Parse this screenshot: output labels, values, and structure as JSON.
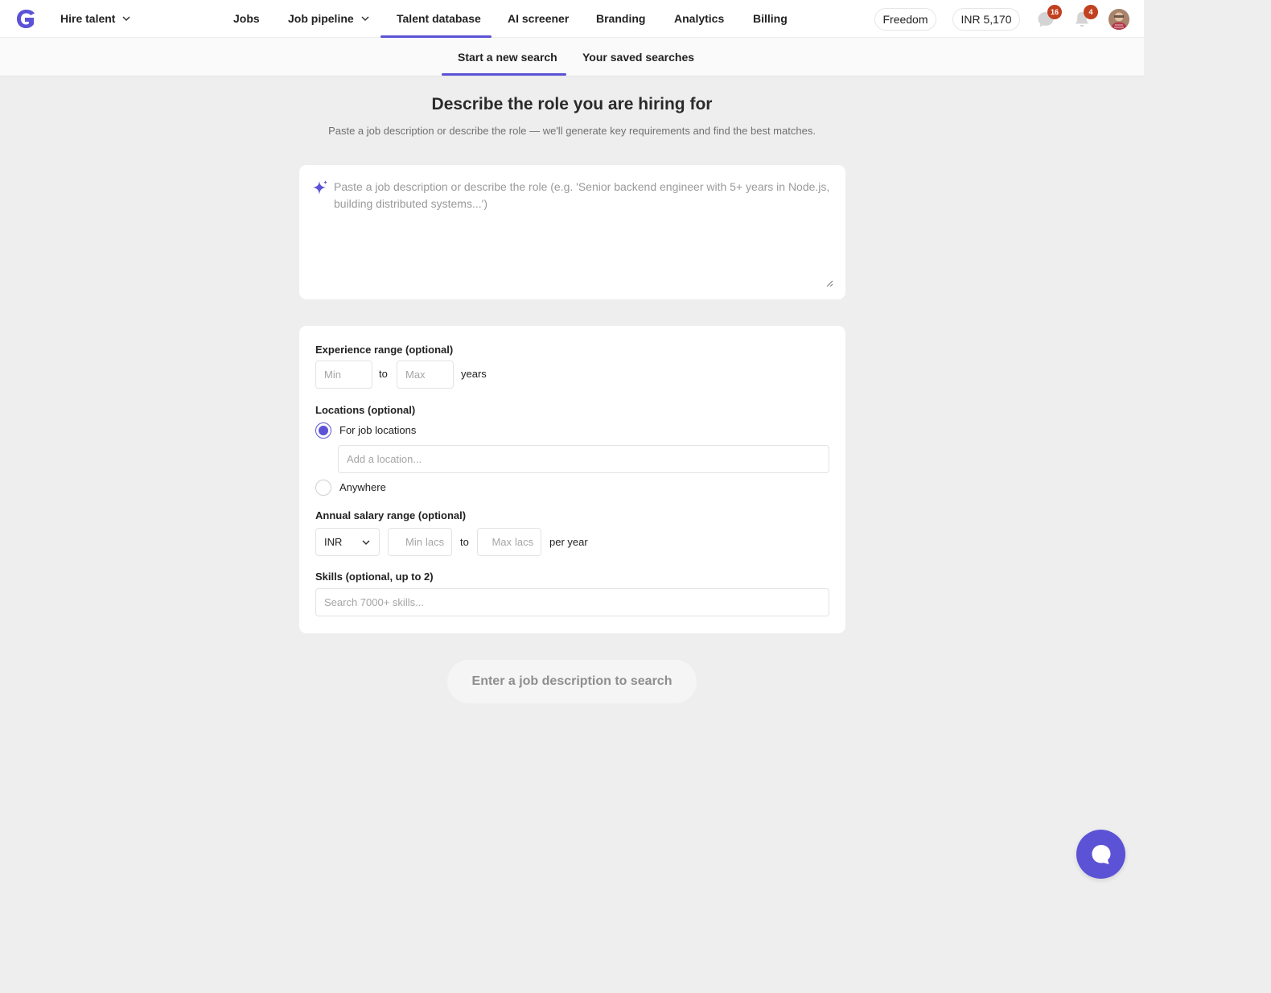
{
  "header": {
    "hire_menu": "Hire talent",
    "nav": [
      {
        "label": "Jobs"
      },
      {
        "label": "Job pipeline"
      },
      {
        "label": "Talent database"
      },
      {
        "label": "AI screener"
      },
      {
        "label": "Branding"
      },
      {
        "label": "Analytics"
      },
      {
        "label": "Billing"
      }
    ],
    "plan": "Freedom",
    "balance": "INR 5,170",
    "messages_count": "16",
    "notifications_count": "4"
  },
  "subnav": {
    "tabs": [
      {
        "label": "Start a new search"
      },
      {
        "label": "Your saved searches"
      }
    ]
  },
  "main": {
    "title": "Describe the role you are hiring for",
    "subtitle": "Paste a job description or describe the role — we'll generate key requirements and find the best matches.",
    "jd_placeholder": "Paste a job description or describe the role (e.g. 'Senior backend engineer with 5+ years in Node.js, building distributed systems...')",
    "jd_value": ""
  },
  "filters": {
    "experience": {
      "label": "Experience range (optional)",
      "min_placeholder": "Min",
      "to": "to",
      "max_placeholder": "Max",
      "unit": "years"
    },
    "locations": {
      "label": "Locations (optional)",
      "option_job": "For job locations",
      "location_placeholder": "Add a location...",
      "option_anywhere": "Anywhere"
    },
    "salary": {
      "label": "Annual salary range (optional)",
      "currency": "INR",
      "min_placeholder": "Min",
      "min_unit": "lacs",
      "to": "to",
      "max_placeholder": "Max",
      "max_unit": "lacs",
      "period": "per year"
    },
    "skills": {
      "label": "Skills (optional, up to 2)",
      "placeholder": "Search 7000+ skills..."
    }
  },
  "search_button": "Enter a job description to search",
  "colors": {
    "accent": "#5b52d6",
    "badge": "#c1401f",
    "page_bg": "#eeeeee"
  }
}
